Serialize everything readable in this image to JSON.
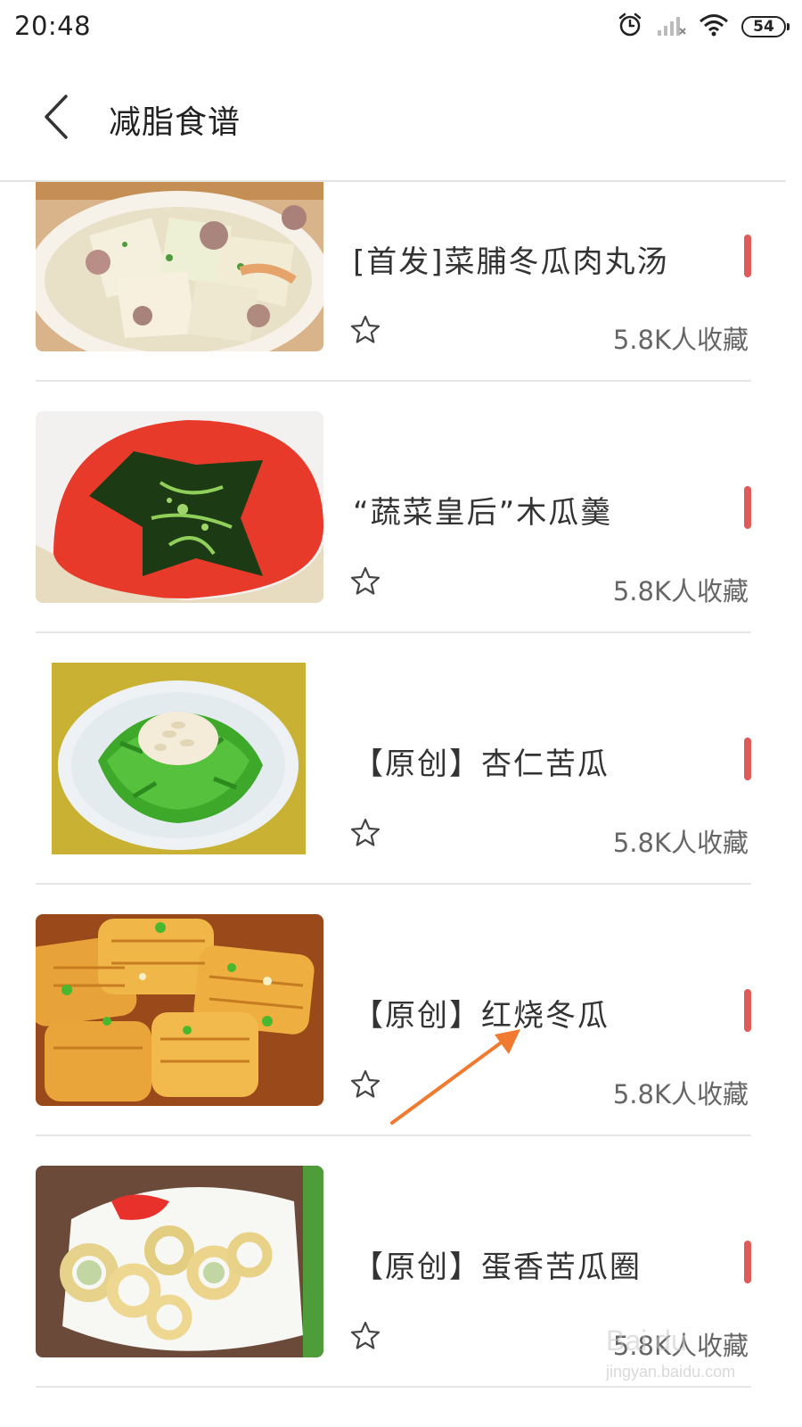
{
  "status_bar": {
    "time": "20:48",
    "battery": "54",
    "icons": [
      "alarm-icon",
      "signal-icon",
      "wifi-icon",
      "battery-icon"
    ]
  },
  "header": {
    "title": "减脂食谱",
    "back_icon": "chevron-left-icon"
  },
  "colors": {
    "accent": "#e05a5a",
    "divider": "#e6e6e6",
    "annotation_arrow": "#f07a30"
  },
  "recipes": [
    {
      "title": "[首发]菜脯冬瓜肉丸汤",
      "favorites": "5.8K人收藏",
      "image": "winter-melon-meatball-soup"
    },
    {
      "title": "“蔬菜皇后”木瓜羹",
      "favorites": "5.8K人收藏",
      "image": "papaya-soup"
    },
    {
      "title": "【原创】杏仁苦瓜",
      "favorites": "5.8K人收藏",
      "image": "almond-bitter-melon"
    },
    {
      "title": "【原创】红烧冬瓜",
      "favorites": "5.8K人收藏",
      "image": "braised-winter-melon"
    },
    {
      "title": "【原创】蛋香苦瓜圈",
      "favorites": "5.8K人收藏",
      "image": "fried-bitter-melon-rings"
    }
  ],
  "watermark": {
    "brand": "Bai du",
    "url": "jingyan.baidu.com"
  }
}
